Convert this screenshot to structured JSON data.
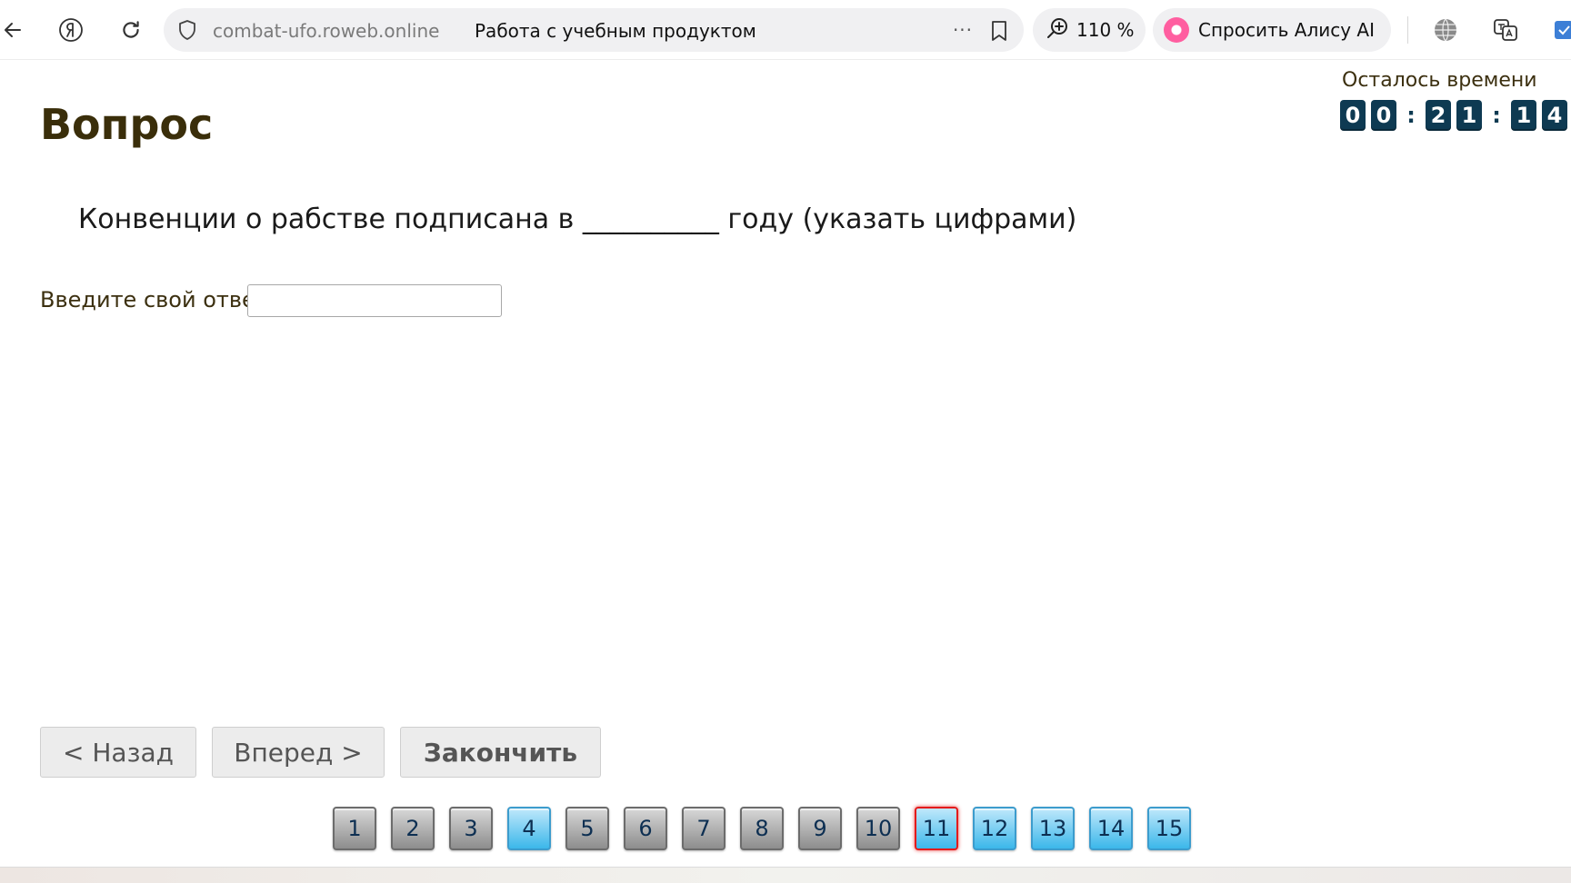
{
  "browser": {
    "host": "combat-ufo.roweb.online",
    "tab_title": "Работа с учебным продуктом",
    "zoom": "110 %",
    "alice_label": "Спросить Алису AI",
    "more_glyph": "···"
  },
  "timer": {
    "label": "Осталось времени",
    "digits": [
      "0",
      "0",
      "2",
      "1",
      "1",
      "4"
    ],
    "separator": ":"
  },
  "question": {
    "heading": "Вопрос",
    "text": "Конвенции о рабстве подписана в __________ году (указать цифрами)",
    "answer_label": "Введите свой ответ",
    "answer_value": ""
  },
  "buttons": {
    "back": "< Назад",
    "forward": "Вперед >",
    "finish": "Закончить"
  },
  "question_nav": [
    {
      "label": "1",
      "state": "answered"
    },
    {
      "label": "2",
      "state": "answered"
    },
    {
      "label": "3",
      "state": "answered"
    },
    {
      "label": "4",
      "state": "unanswered"
    },
    {
      "label": "5",
      "state": "answered"
    },
    {
      "label": "6",
      "state": "answered"
    },
    {
      "label": "7",
      "state": "answered"
    },
    {
      "label": "8",
      "state": "answered"
    },
    {
      "label": "9",
      "state": "answered"
    },
    {
      "label": "10",
      "state": "answered"
    },
    {
      "label": "11",
      "state": "current"
    },
    {
      "label": "12",
      "state": "unanswered"
    },
    {
      "label": "13",
      "state": "unanswered"
    },
    {
      "label": "14",
      "state": "unanswered"
    },
    {
      "label": "15",
      "state": "unanswered"
    }
  ],
  "colors": {
    "heading": "#3a2e0a",
    "timer_digit_bg": "#0e3a52",
    "nav_blue": "#3bb7ea",
    "nav_current_border": "#e31b1b"
  }
}
